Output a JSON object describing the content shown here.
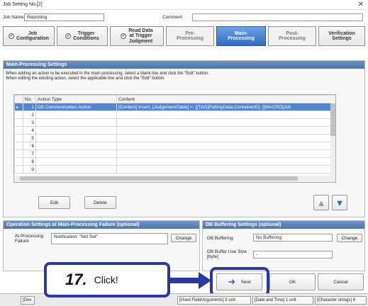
{
  "window": {
    "title": "Job Setting No.[2]"
  },
  "job": {
    "name_label": "Job Name",
    "name_value": "Reporting",
    "comment_label": "Comment",
    "comment_value": ""
  },
  "steps": [
    {
      "line1": "Job",
      "line2": "Configuration",
      "state": "done"
    },
    {
      "line1": "Trigger",
      "line2": "Conditions",
      "state": "done"
    },
    {
      "line1": "Read Data",
      "line2": "at Trigger",
      "line3": "Judgment",
      "state": "done"
    },
    {
      "line1": "Pre-",
      "line2": "Processing",
      "state": "inactive"
    },
    {
      "line1": "Main-",
      "line2": "Processing",
      "state": "active"
    },
    {
      "line1": "Post-",
      "line2": "Processing",
      "state": "inactive"
    },
    {
      "line1": "Verification",
      "line2": "Settings",
      "state": "normal"
    }
  ],
  "main": {
    "section_title": "Main-Processing Settings",
    "desc1": "When adding an action to be executed in the main-processing, select a blank line and click the \"Edit\" button.",
    "desc2": "When editing the existing action, select the applicable line and click the \"Edit\" button.",
    "columns": [
      "No.",
      "Action Type",
      "Content"
    ],
    "rows": [
      {
        "no": "1",
        "type": "DB Communication Action",
        "content": "[Content] Insert, [JudgementTable] <- [[TAG]PuttingData.ContainerID], [[MACRO]Job"
      },
      {
        "no": "2",
        "type": "",
        "content": ""
      },
      {
        "no": "3",
        "type": "",
        "content": ""
      },
      {
        "no": "4",
        "type": "",
        "content": ""
      },
      {
        "no": "5",
        "type": "",
        "content": ""
      },
      {
        "no": "6",
        "type": "",
        "content": ""
      },
      {
        "no": "7",
        "type": "",
        "content": ""
      },
      {
        "no": "8",
        "type": "",
        "content": ""
      },
      {
        "no": "9",
        "type": "",
        "content": ""
      }
    ],
    "edit_label": "Edit",
    "delete_label": "Delete"
  },
  "failure": {
    "section_title": "Operation Settings at Main-Processing Failure (optional)",
    "label": "At Processing Failure",
    "value": "Notification: \"Not Set\"",
    "change_label": "Change"
  },
  "buffering": {
    "section_title": "DB Buffering Settings (optional)",
    "label": "DB Buffering",
    "value": "No Buffering",
    "change_label": "Change",
    "size_label": "DB Buffer Use Size [byte]",
    "size_value": "-"
  },
  "footer": {
    "next_label": "Next",
    "ok_label": "OK",
    "cancel_label": "Cancel"
  },
  "callout": {
    "number": "17.",
    "text": "Click!",
    "accent": "#2b3a9a"
  },
  "status": {
    "dev": "[Dev",
    "used_field": "[Used Field/Arguments]",
    "used_field_val": "5 unit",
    "datetime": "[Date and Time]",
    "datetime_val": "1 unit",
    "charstr": "[Character strings]",
    "charstr_val": "6"
  }
}
